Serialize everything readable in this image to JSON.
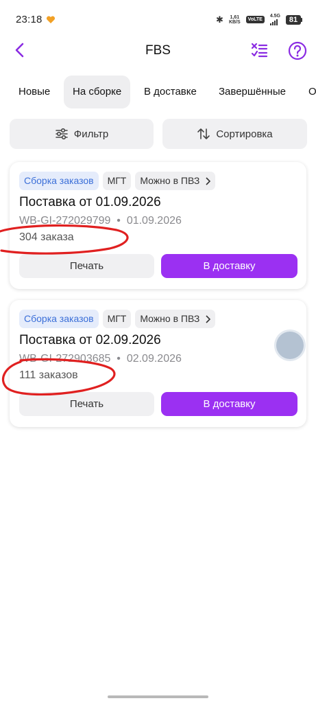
{
  "status_bar": {
    "time": "23:18",
    "speed_top": "1,61",
    "speed_bottom": "KB/S",
    "volte": "VoLTE",
    "network": "4.5G",
    "battery": "81"
  },
  "header": {
    "title": "FBS"
  },
  "tabs": [
    {
      "label": "Новые",
      "active": false
    },
    {
      "label": "На сборке",
      "active": true
    },
    {
      "label": "В доставке",
      "active": false
    },
    {
      "label": "Завершённые",
      "active": false
    },
    {
      "label": "О",
      "active": false
    }
  ],
  "controls": {
    "filter_label": "Фильтр",
    "sort_label": "Сортировка"
  },
  "supplies": [
    {
      "tags": [
        "Сборка заказов",
        "МГТ",
        "Можно в ПВЗ"
      ],
      "title": "Поставка от 01.09.2026",
      "supply_id": "WB-GI-272029799",
      "date": "01.09.2026",
      "orders_count": "304 заказа",
      "print_label": "Печать",
      "deliver_label": "В доставку"
    },
    {
      "tags": [
        "Сборка заказов",
        "МГТ",
        "Можно в ПВЗ"
      ],
      "title": "Поставка от 02.09.2026",
      "supply_id": "WB-GI-272903685",
      "date": "02.09.2026",
      "orders_count": "111 заказов",
      "print_label": "Печать",
      "deliver_label": "В доставку"
    }
  ],
  "colors": {
    "accent": "#9b30f2",
    "tag_blue_text": "#3b6fd8",
    "tag_blue_bg": "#e5ecfb",
    "annotation_red": "#e02020"
  }
}
